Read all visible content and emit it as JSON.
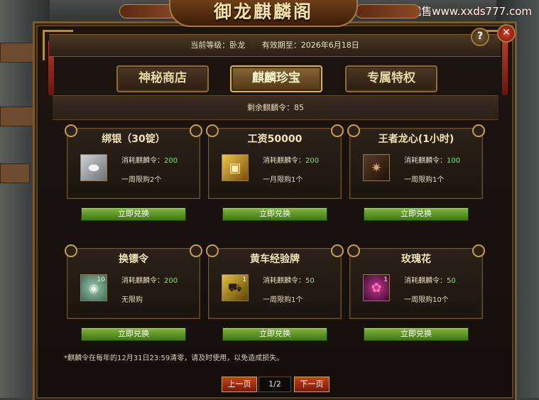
{
  "watermark": "小雪代售www.xxds777.com",
  "title": "御龙麒麟阁",
  "header": {
    "level_label": "当前等级：卧龙",
    "expiry_label": "有效期至：2026年6月18日"
  },
  "icons": {
    "help": "help-icon",
    "close": "close-icon"
  },
  "tabs": [
    {
      "label": "神秘商店",
      "active": false
    },
    {
      "label": "麒麟珍宝",
      "active": true
    },
    {
      "label": "专属特权",
      "active": false
    }
  ],
  "remaining": "剩余麒麟令：85",
  "items": [
    {
      "name": "绑银（30锭）",
      "cost_label": "消耗麒麟令：",
      "cost": "200",
      "limit": "一周限购2个",
      "qty": "",
      "icon": "silver-ingot-icon"
    },
    {
      "name": "工资50000",
      "cost_label": "消耗麒麟令：",
      "cost": "200",
      "limit": "一月限购1个",
      "qty": "",
      "icon": "gold-package-icon"
    },
    {
      "name": "王者龙心(1小时)",
      "cost_label": "消耗麒麟令：",
      "cost": "100",
      "limit": "一周限购1个",
      "qty": "",
      "icon": "dragon-heart-icon"
    },
    {
      "name": "换镖令",
      "cost_label": "消耗麒麟令：",
      "cost": "200",
      "limit": "无限购",
      "qty": "10",
      "icon": "escort-token-icon"
    },
    {
      "name": "黄车经验牌",
      "cost_label": "消耗麒麟令：",
      "cost": "50",
      "limit": "一周限购1个",
      "qty": "1",
      "icon": "yellow-cart-icon"
    },
    {
      "name": "玫瑰花",
      "cost_label": "消耗麒麟令：",
      "cost": "50",
      "limit": "一周限购10个",
      "qty": "1",
      "icon": "rose-icon"
    }
  ],
  "redeem_label": "立即兑换",
  "note": "*麒麟令在每年的12月31日23:59清零，请及时使用，以免造成损失。",
  "pager": {
    "prev": "上一页",
    "page": "1/2",
    "next": "下一页"
  },
  "colors": {
    "accent_green": "#8be07a",
    "button_green": "#5c9a28",
    "pager_red": "#a52c12",
    "gold_border": "#c89d4b"
  }
}
